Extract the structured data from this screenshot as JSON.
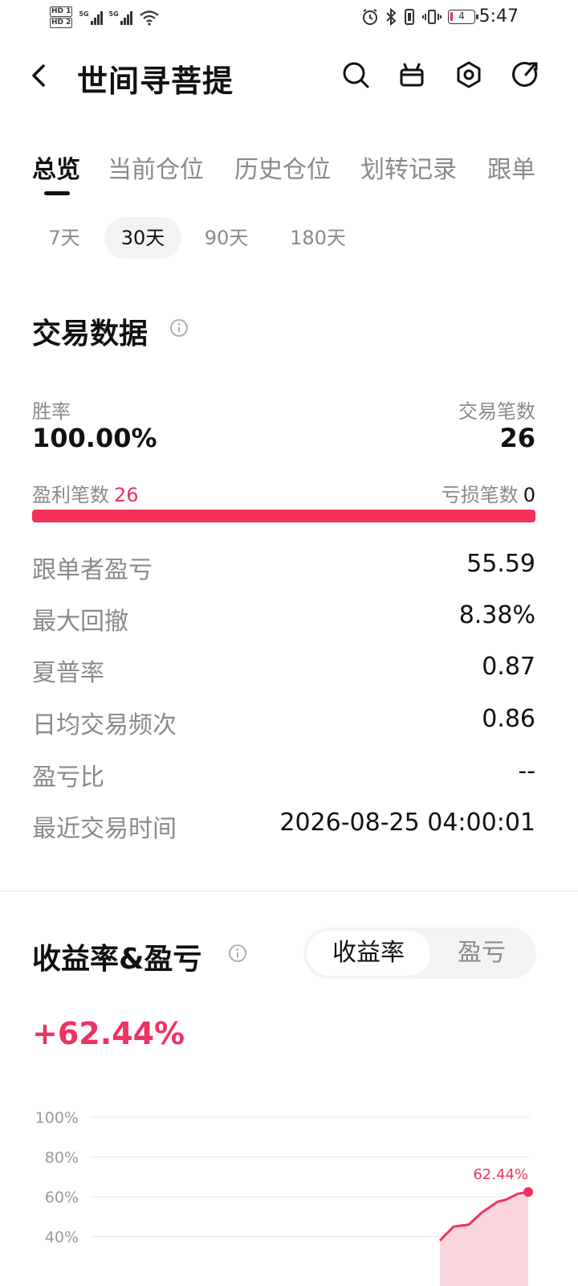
{
  "status_bar": {
    "hd1": "HD 1",
    "hd2": "HD 2",
    "net1": "5G",
    "net2": "5G",
    "battery": "4",
    "time": "5:47"
  },
  "header": {
    "title": "世间寻菩提",
    "icons": [
      "back-icon",
      "search-icon",
      "gift-icon",
      "settings-icon",
      "share-icon"
    ]
  },
  "tabs": [
    "总览",
    "当前仓位",
    "历史仓位",
    "划转记录",
    "跟单"
  ],
  "periods": [
    "7天",
    "30天",
    "90天",
    "180天"
  ],
  "trade_data": {
    "title": "交易数据",
    "win_rate_label": "胜率",
    "win_rate": "100.00%",
    "trades_label": "交易笔数",
    "trades": "26",
    "profit_label": "盈利笔数",
    "profit_count": "26",
    "loss_label": "亏损笔数",
    "loss_count": "0",
    "profit_ratio": 1.0,
    "stats": [
      {
        "label": "跟单者盈亏",
        "value": "55.59"
      },
      {
        "label": "最大回撤",
        "value": "8.38%"
      },
      {
        "label": "夏普率",
        "value": "0.87"
      },
      {
        "label": "日均交易频次",
        "value": "0.86"
      },
      {
        "label": "盈亏比",
        "value": "--"
      },
      {
        "label": "最近交易时间",
        "value": "2026-08-25 04:00:01"
      }
    ]
  },
  "returns": {
    "title": "收益率&盈亏",
    "toggle": [
      "收益率",
      "盈亏"
    ],
    "total_return": "+62.44%"
  },
  "colors": {
    "accent": "#ee3361",
    "progress": "#f4315a",
    "area_fill": "#fcd6de"
  },
  "chart_data": {
    "type": "area",
    "y_ticks": [
      "100%",
      "80%",
      "60%",
      "40%"
    ],
    "ylim": [
      40,
      100
    ],
    "end_label": "62.44%",
    "values": [
      38,
      45,
      46,
      52,
      57.5,
      58.5,
      61.5,
      62.44
    ]
  }
}
